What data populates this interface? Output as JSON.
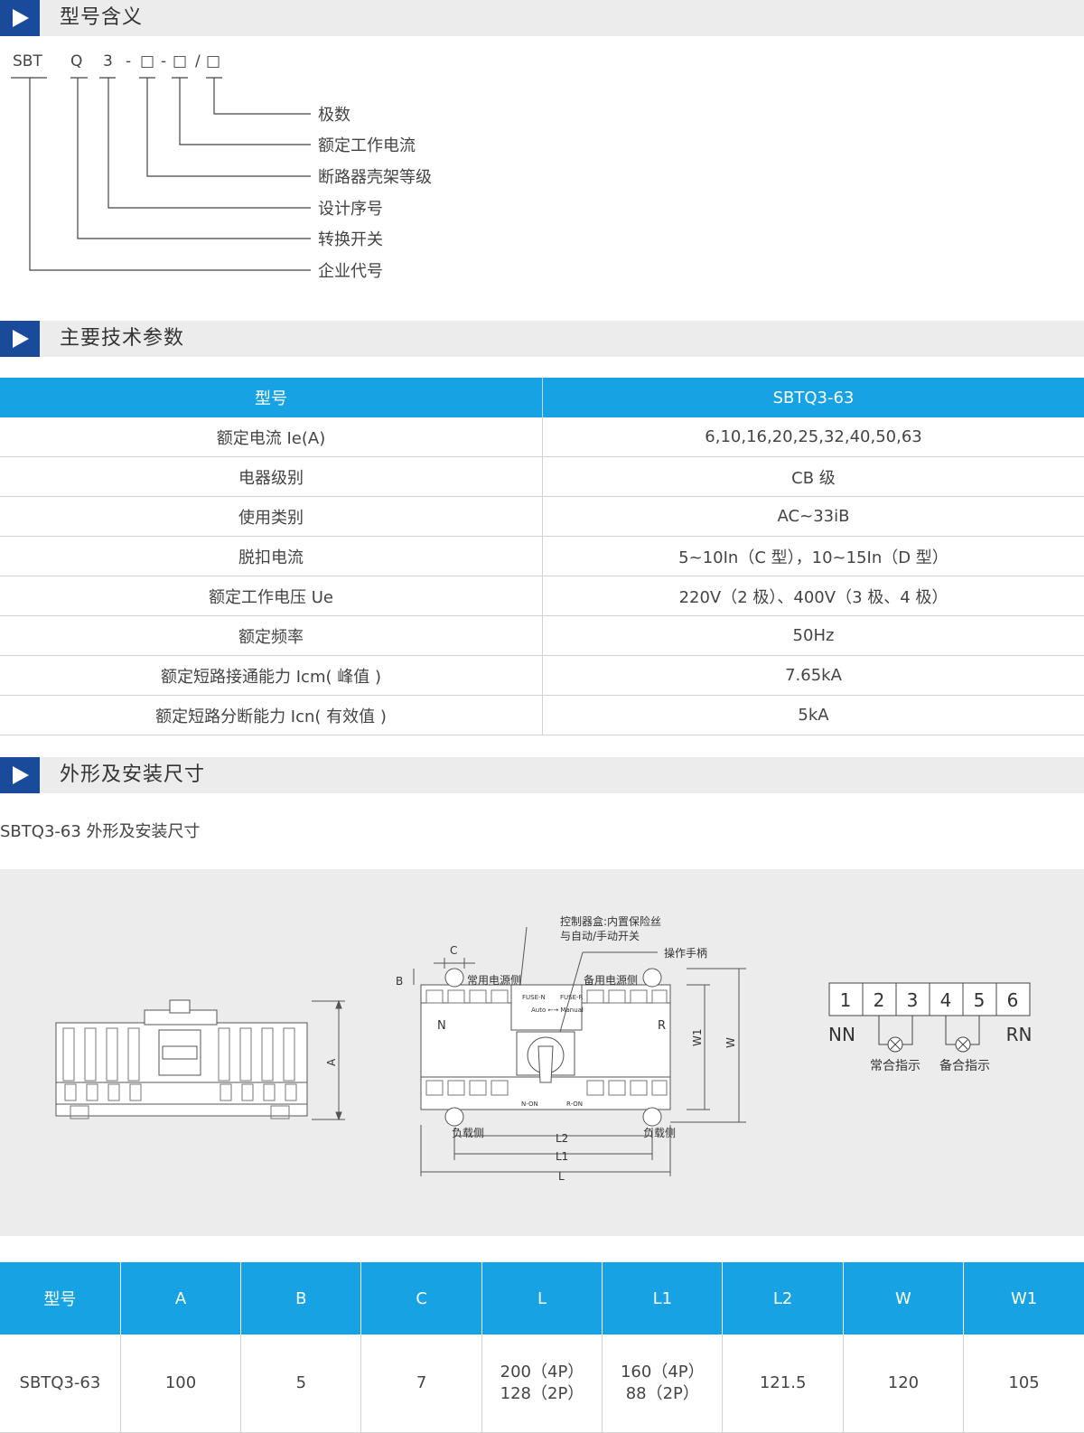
{
  "sections": {
    "model_meaning": "型号含义",
    "tech_params": "主要技术参数",
    "dimensions": "外形及安装尺寸"
  },
  "model_code": {
    "parts": [
      "SBT",
      "Q",
      "3",
      "-",
      "□",
      "-",
      "□",
      "/",
      "□"
    ],
    "labels": [
      "极数",
      "额定工作电流",
      "断路器壳架等级",
      "设计序号",
      "转换开关",
      "企业代号"
    ]
  },
  "params_table": {
    "headers": [
      "型号",
      "SBTQ3-63"
    ],
    "rows": [
      [
        "额定电流 Ie(A)",
        "6,10,16,20,25,32,40,50,63"
      ],
      [
        "电器级别",
        "CB 级"
      ],
      [
        "使用类别",
        "AC~33iB"
      ],
      [
        "脱扣电流",
        "5~10In（C 型），10~15In（D 型）"
      ],
      [
        "额定工作电压 Ue",
        "220V（2 极）、400V（3 极、4 极）"
      ],
      [
        "额定频率",
        "50Hz"
      ],
      [
        "额定短路接通能力 Icm( 峰值 )",
        "7.65kA"
      ],
      [
        "额定短路分断能力 Icn( 有效值 )",
        "5kA"
      ]
    ]
  },
  "caption": "SBTQ3-63 外形及安装尺寸",
  "drawing": {
    "side_dim": "A",
    "top_labels": {
      "control_box_1": "控制器盒:内置保险丝",
      "control_box_2": "与自动/手动开关",
      "handle": "操作手柄",
      "normal_side": "常用电源侧",
      "backup_side": "备用电源侧",
      "load_side_left": "负载侧",
      "load_side_right": "负载侧",
      "n": "N",
      "r": "R",
      "c": "C",
      "b": "B",
      "w1": "W1",
      "w": "W",
      "l2": "L2",
      "l1": "L1",
      "l": "L",
      "fuse_n": "FUSE-N",
      "fuse_r": "FUSE-R",
      "auto_manual": "Auto ←→ Manual",
      "n_on": "N-ON",
      "r_on": "R-ON"
    },
    "terminals": {
      "numbers": [
        "1",
        "2",
        "3",
        "4",
        "5",
        "6"
      ],
      "nn": "NN",
      "rn": "RN",
      "normal_indicator": "常合指示",
      "backup_indicator": "备合指示"
    }
  },
  "dims_table": {
    "headers": [
      "型号",
      "A",
      "B",
      "C",
      "L",
      "L1",
      "L2",
      "W",
      "W1"
    ],
    "row": {
      "model": "SBTQ3-63",
      "a": "100",
      "b": "5",
      "c": "7",
      "l_1": "200（4P）",
      "l_2": "128（2P）",
      "l1_1": "160（4P）",
      "l1_2": "88（2P）",
      "l2": "121.5",
      "w": "120",
      "w1": "105"
    }
  },
  "colors": {
    "accent_blue": "#17a2e3",
    "icon_navy": "#1a4b9b",
    "section_bg": "#ececec"
  }
}
